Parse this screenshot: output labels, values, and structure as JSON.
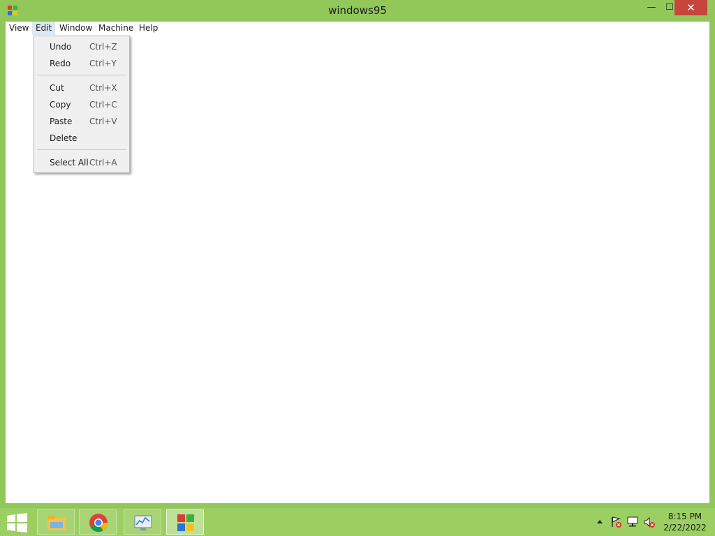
{
  "window": {
    "title": "windows95",
    "close_glyph": "✕",
    "minimize_glyph": "—",
    "maximize_glyph": "☐"
  },
  "menubar": {
    "items": [
      {
        "label": "View"
      },
      {
        "label": "Edit"
      },
      {
        "label": "Window"
      },
      {
        "label": "Machine"
      },
      {
        "label": "Help"
      }
    ],
    "active": "Edit"
  },
  "edit_menu": {
    "items": [
      {
        "label": "Undo",
        "shortcut": "Ctrl+Z"
      },
      {
        "label": "Redo",
        "shortcut": "Ctrl+Y"
      },
      {
        "label": "Cut",
        "shortcut": "Ctrl+X"
      },
      {
        "label": "Copy",
        "shortcut": "Ctrl+C"
      },
      {
        "label": "Paste",
        "shortcut": "Ctrl+V"
      },
      {
        "label": "Delete",
        "shortcut": ""
      },
      {
        "label": "Select All",
        "shortcut": "Ctrl+A"
      }
    ]
  },
  "taskbar": {
    "buttons": [
      {
        "icon": "file-explorer-icon"
      },
      {
        "icon": "chrome-icon"
      },
      {
        "icon": "resource-monitor-icon"
      },
      {
        "icon": "windows95-icon",
        "active": true
      }
    ],
    "tray_icons": [
      "show-hidden-icons-chevron",
      "action-center-flag-icon",
      "network-icon",
      "volume-muted-icon"
    ],
    "time": "8:15 PM",
    "date": "2/22/2022"
  },
  "colors": {
    "frame": "#92c85a",
    "taskbar": "#9ccf62",
    "close_button": "#c7463c",
    "menu_highlight": "#dde8f3"
  }
}
